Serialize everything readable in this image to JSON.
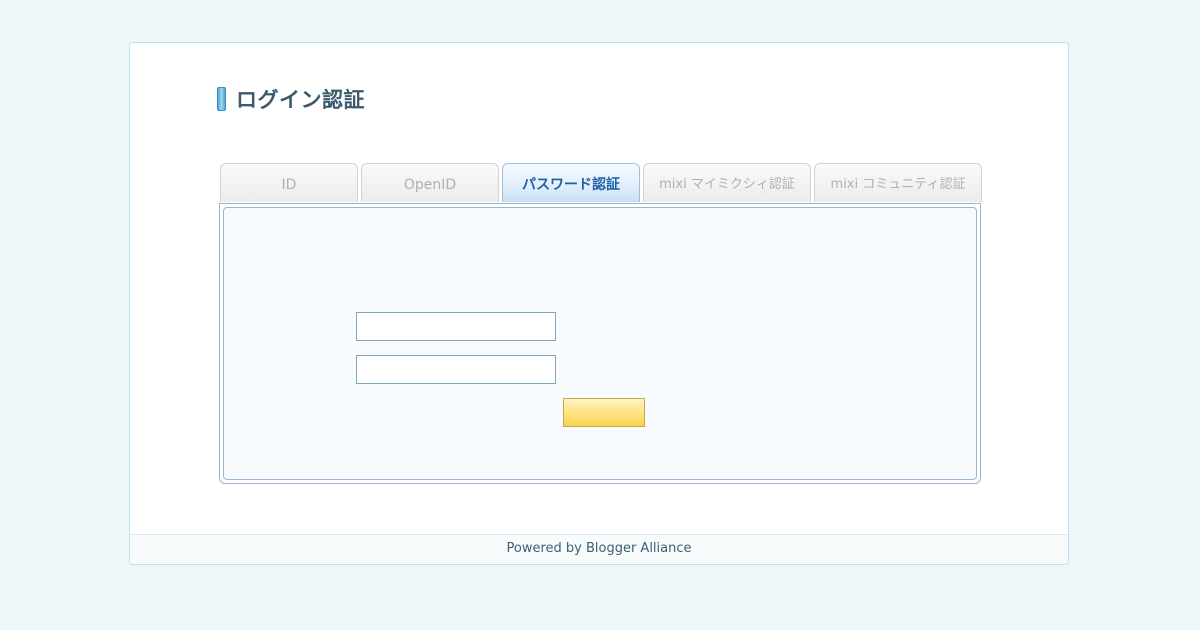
{
  "page": {
    "title": "ログイン認証"
  },
  "tabs": [
    {
      "label": "ID",
      "active": false
    },
    {
      "label": "OpenID",
      "active": false
    },
    {
      "label": "パスワード認証",
      "active": true
    },
    {
      "label": "mixi マイミクシィ認証",
      "active": false
    },
    {
      "label": "mixi コミュニティ認証",
      "active": false
    }
  ],
  "form": {
    "username_value": "",
    "username_placeholder": "",
    "password_value": "",
    "password_placeholder": "",
    "submit_label": ""
  },
  "footer": {
    "text": "Powered by Blogger Alliance"
  },
  "colors": {
    "page_background": "#eef6fa",
    "card_border": "#bfe0ef",
    "active_tab_text": "#1f5fa3",
    "submit_button": "#ffe07a"
  }
}
